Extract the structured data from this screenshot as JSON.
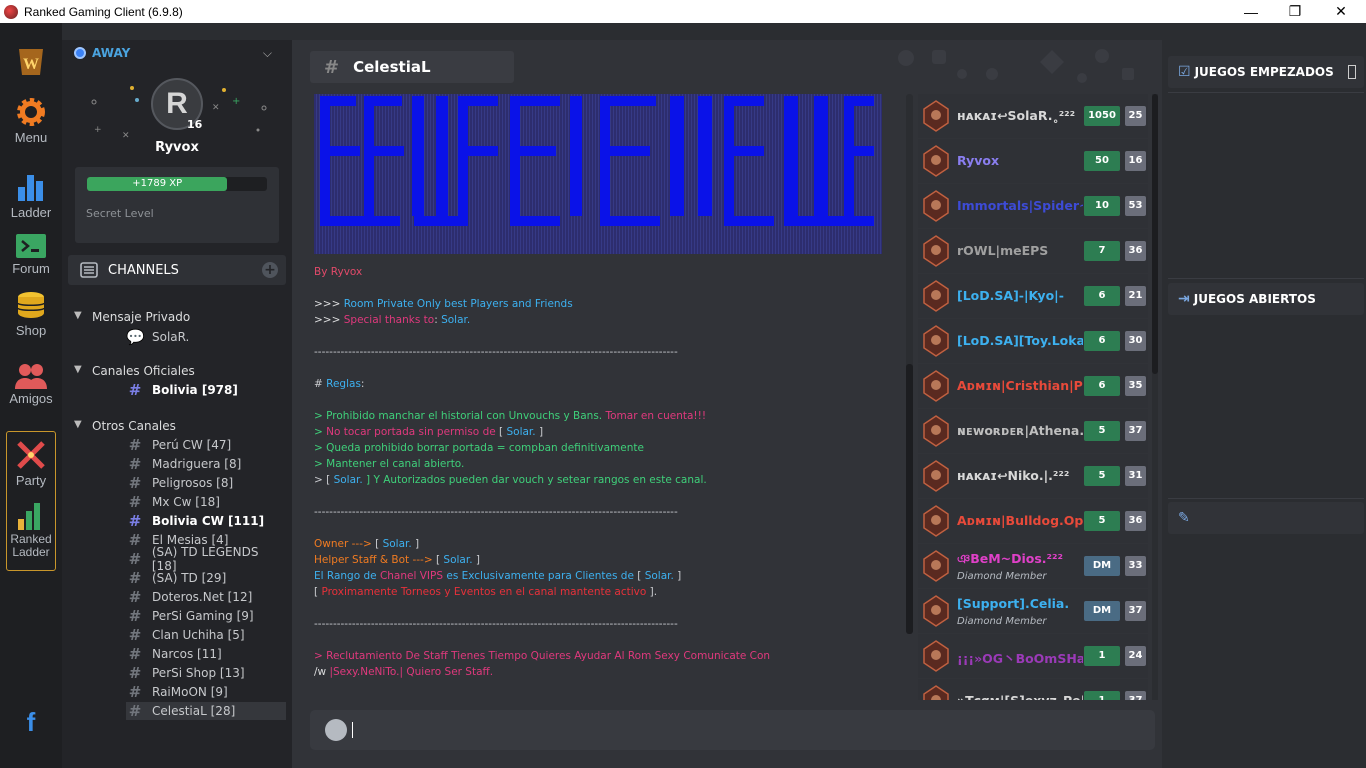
{
  "window": {
    "title": "Ranked Gaming Client (6.9.8)",
    "minimize": "—",
    "maximize": "❐",
    "close": "✕"
  },
  "nav": {
    "menu": "Menu",
    "ladder": "Ladder",
    "forum": "Forum",
    "shop": "Shop",
    "amigos": "Amigos",
    "party": "Party",
    "ranked_ladder": "Ranked Ladder"
  },
  "profile": {
    "status": "AWAY",
    "name": "Ryvox",
    "level": "16",
    "xp": "+1789 XP",
    "xp_fraction": 0.78,
    "secret_level": "Secret Level",
    "avatar_letter": "R"
  },
  "channels": {
    "header": "CHANNELS",
    "groups": [
      {
        "name": "Mensaje Privado"
      },
      {
        "name": "Canales Oficiales"
      },
      {
        "name": "Otros Canales"
      }
    ],
    "private": [
      "SolaR."
    ],
    "oficiales": [
      "Bolivia [978]"
    ],
    "otros": [
      "Perú CW [47]",
      "Madriguera [8]",
      "Peligrosos [8]",
      "Mx Cw [18]",
      "Bolivia CW [111]",
      "El Mesias [4]",
      "(SA) TD LEGENDS [18]",
      "(SA) TD [29]",
      "Doteros.Net [12]",
      "PerSi Gaming [9]",
      "Clan Uchiha [5]",
      "Narcos [11]",
      "PerSi Shop [13]",
      "RaiMoON [9]",
      "CelestiaL [28]"
    ]
  },
  "room": {
    "name": "CelestiaL"
  },
  "chat": {
    "by": "By Ryvox",
    "l1a": ">>> ",
    "l1b": "Room Private Only best Players and Friends",
    ".": ".",
    "l2a": ">>> ",
    "l2b": "Special thanks to",
    ":": ": ",
    "l2c": "Solar.",
    "dash": "------------------------------------------------------------------------------------------------",
    "r0a": "# ",
    "r0b": "Reglas",
    ":2": ":",
    "r1a": "> Prohibido manchar el historial con Unvouchs y Bans. ",
    "r1b": "Tomar en cuenta!!!",
    "r2a": "> ",
    "r2b": "No tocar portada sin permiso de",
    "r2c": " [ ",
    "r2d": "Solar.",
    "r2e": " ]",
    "r3": "> Queda prohibido borrar portada = compban definitivamente",
    "r4": "> Mantener el canal abierto.",
    "r5a": "> [ ",
    "r5b": "Solar.",
    "r5c": " ] Y Autorizados pueden dar vouch y setear rangos en este canal.",
    "o1a": "Owner  --->",
    "o1b": " [ ",
    "o1c": "Solar.",
    "o1d": " ]",
    "o2a": "Helper Staff & Bot  --->",
    "o2b": " [ ",
    "o2c": "Solar.",
    "o2d": " ]",
    "o3a": "El Rango de ",
    "o3b": "Chanel VIPS",
    "o3c": " es Exclusivamente para Clientes de",
    "o3d": " [ ",
    "o3e": "Solar.",
    "o3f": " ]",
    "o4a": "[ ",
    "o4b": "Proximamente Torneos y Eventos en el canal mantente activo",
    "o4c": " ].",
    "s1": "> Reclutamiento De Staff Tienes Tiempo Quieres Ayudar Al Rom Sexy Comunicate Con",
    "s2a": "/w ",
    "s2b": "|Sexy.NeNiTo.|",
    "s2c": " Quiero Ser Staff."
  },
  "users": [
    {
      "name": "ʜᴀᴋᴀɪ↩SolaR.˳²²²",
      "color": "#d8d8d8",
      "b1": "1050",
      "b2": "25"
    },
    {
      "name": "Ryvox",
      "color": "#8a7ef0",
      "b1": "50",
      "b2": "16"
    },
    {
      "name": "Immortals|Spider~M",
      "color": "#3d4bd6",
      "b1": "10",
      "b2": "53"
    },
    {
      "name": "rOWL|meEPS",
      "color": "#a0a0a0",
      "b1": "7",
      "b2": "36"
    },
    {
      "name": "[LoD.SA]-|Kyo|-",
      "color": "#3db1f0",
      "b1": "6",
      "b2": "21"
    },
    {
      "name": "[LoD.SA][Toy.Lokazo",
      "color": "#3db1f0",
      "b1": "6",
      "b2": "30"
    },
    {
      "name": "Aᴅᴍɪɴ|Cristhian|Pe",
      "color": "#e84a3a",
      "b1": "6",
      "b2": "35"
    },
    {
      "name": "ɴᴇᴡᴏʀᴅᴇʀ|Athena.",
      "color": "#bfbfbf",
      "b1": "5",
      "b2": "37"
    },
    {
      "name": "ʜᴀᴋᴀɪ↩Niko.|.²²²",
      "color": "#d8d8d8",
      "b1": "5",
      "b2": "31"
    },
    {
      "name": "Aᴅᴍɪɴ|Bulldog.Op",
      "color": "#e84a3a",
      "b1": "5",
      "b2": "36"
    },
    {
      "name": "ঞBeM~Dios.²²²",
      "color": "#e040c8",
      "sub": "Diamond Member",
      "b1": "DM",
      "b2": "33"
    },
    {
      "name": "[Support].Celia.",
      "color": "#3db1f0",
      "sub": "Diamond Member",
      "b1": "DM",
      "b2": "37"
    },
    {
      "name": "¡¡¡»OG丶BoOmSHaKa",
      "color": "#9b3ab8",
      "b1": "1",
      "b2": "24"
    },
    {
      "name": "»Tєαм|[S]exyz_Pe|E",
      "color": "#d8d8d8",
      "b1": "1",
      "b2": "37"
    }
  ],
  "games": {
    "started": "JUEGOS EMPEZADOS",
    "open": "JUEGOS ABIERTOS"
  }
}
